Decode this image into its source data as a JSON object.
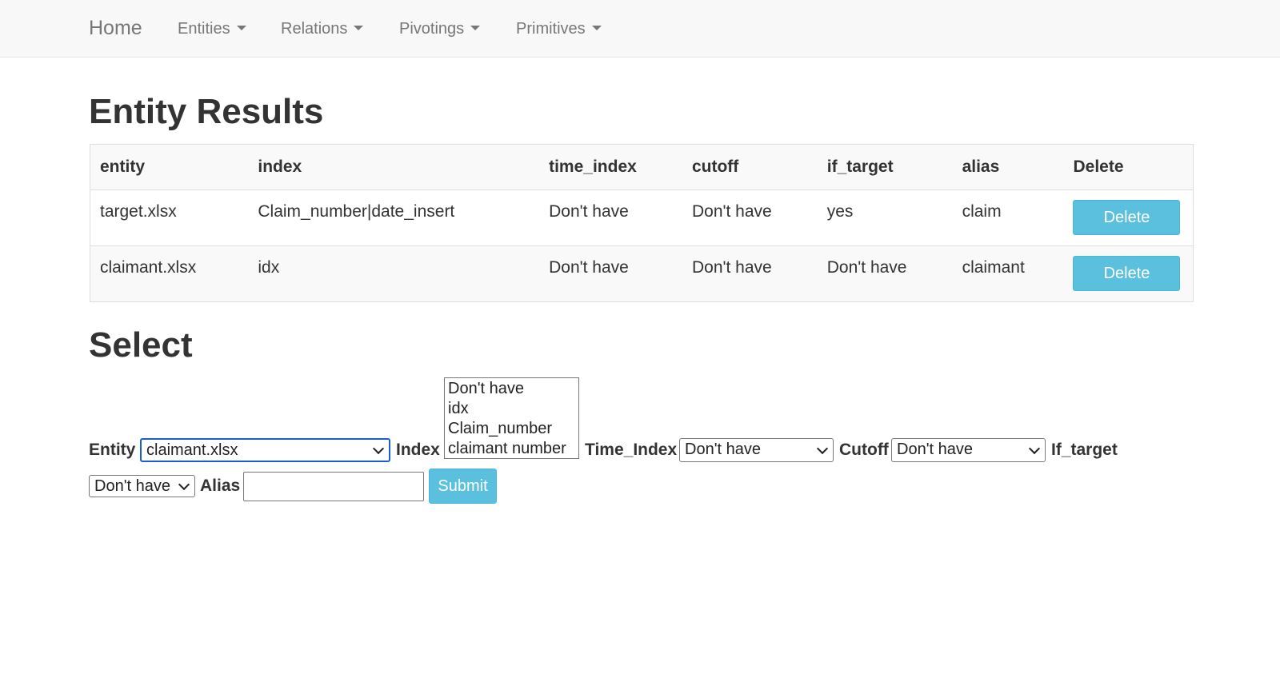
{
  "navbar": {
    "brand": "Home",
    "items": [
      {
        "label": "Entities"
      },
      {
        "label": "Relations"
      },
      {
        "label": "Pivotings"
      },
      {
        "label": "Primitives"
      }
    ]
  },
  "results": {
    "title": "Entity Results",
    "columns": [
      "entity",
      "index",
      "time_index",
      "cutoff",
      "if_target",
      "alias",
      "Delete"
    ],
    "rows": [
      {
        "entity": "target.xlsx",
        "index": "Claim_number|date_insert",
        "time_index": "Don't have",
        "cutoff": "Don't have",
        "if_target": "yes",
        "alias": "claim",
        "delete_label": "Delete"
      },
      {
        "entity": "claimant.xlsx",
        "index": "idx",
        "time_index": "Don't have",
        "cutoff": "Don't have",
        "if_target": "Don't have",
        "alias": "claimant",
        "delete_label": "Delete"
      }
    ]
  },
  "select_form": {
    "title": "Select",
    "entity_label": "Entity",
    "entity_value": "claimant.xlsx",
    "index_label": "Index",
    "index_options": [
      "Don't have",
      "idx",
      "Claim_number",
      "claimant number"
    ],
    "time_index_label": "Time_Index",
    "time_index_value": "Don't have",
    "cutoff_label": "Cutoff",
    "cutoff_value": "Don't have",
    "if_target_label": "If_target",
    "if_target_value": "Don't have",
    "alias_label": "Alias",
    "alias_value": "",
    "submit_label": "Submit"
  },
  "colors": {
    "navbar_bg": "#f8f8f8",
    "button_info": "#5bc0de",
    "focus_ring": "#1a5fd0"
  }
}
